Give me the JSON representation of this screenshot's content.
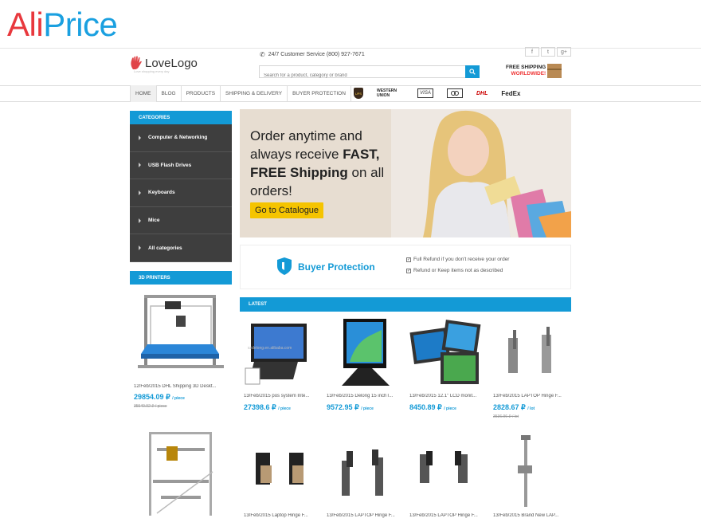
{
  "brand": {
    "ali": "Ali",
    "price": "Price"
  },
  "header": {
    "logo_text": "LoveLogo",
    "logo_tagline": "Love shopping every day",
    "service": "24/7 Customer Service (800) 927-7671",
    "search_placeholder": "Search for a product, category or brand",
    "social": [
      "f",
      "t",
      "g+"
    ],
    "free_shipping_line1": "FREE SHIPPING",
    "free_shipping_line2": "WORLDWIDE!"
  },
  "nav": {
    "items": [
      "HOME",
      "BLOG",
      "PRODUCTS",
      "SHIPPING & DELIVERY",
      "BUYER PROTECTION"
    ],
    "payments": {
      "ups": "UPS",
      "western_union": "WESTERN UNION",
      "visa": "VISA",
      "dhl": "DHL",
      "fedex": "FedEx"
    }
  },
  "sidebar": {
    "categories_title": "CATEGORIES",
    "categories": [
      "Computer & Networking",
      "USB Flash Drives",
      "Keyboards",
      "Mice",
      "All categories"
    ],
    "printers_title": "3D PRINTERS",
    "products": [
      {
        "caption": "12/Feb/2015 DHL Shipping 3D Deskt...",
        "price": "29854.09 ₽",
        "unit": "/ piece",
        "old": "35540.92 ₽ / piece"
      }
    ]
  },
  "banner": {
    "line1": "Order anytime and",
    "line2_pre": "always receive ",
    "line2_bold": "FAST,",
    "line3_bold": "FREE Shipping",
    "line3_post": " on all",
    "line4": "orders!",
    "cta": "Go to Catalogue"
  },
  "protection": {
    "title": "Buyer Protection",
    "points": [
      "Full Refund if you don't receive your order",
      "Refund or Keep items not as described"
    ]
  },
  "latest": {
    "title": "LATEST",
    "products": [
      {
        "caption": "13/Feb/2015 pos system Inte...",
        "price": "27398.6 ₽",
        "unit": "/ piece",
        "old": ""
      },
      {
        "caption": "13/Feb/2015 Delong 15 inchT...",
        "price": "9572.95 ₽",
        "unit": "/ piece",
        "old": ""
      },
      {
        "caption": "13/Feb/2015 12.1\" LCD monit...",
        "price": "8450.89 ₽",
        "unit": "/ piece",
        "old": ""
      },
      {
        "caption": "13/Feb/2015 LAPTOP Hinge F...",
        "price": "2828.67 ₽",
        "unit": "/ lot",
        "old": "3536.96 ₽ / lot"
      },
      {
        "caption": "13/Feb/2015 Laptop Hinge F...",
        "price": "",
        "unit": "",
        "old": ""
      },
      {
        "caption": "13/Feb/2015 LAPTOP Hinge F...",
        "price": "",
        "unit": "",
        "old": ""
      },
      {
        "caption": "13/Feb/2015 LAPTOP Hinge F...",
        "price": "",
        "unit": "",
        "old": ""
      },
      {
        "caption": "13/Feb/2015 Brand New LAP...",
        "price": "",
        "unit": "",
        "old": ""
      }
    ]
  },
  "colors": {
    "accent": "#139ad6",
    "dark": "#3e3e3e",
    "cta": "#f5c400",
    "ali_red": "#e8383d",
    "ali_blue": "#1aa0e0"
  }
}
